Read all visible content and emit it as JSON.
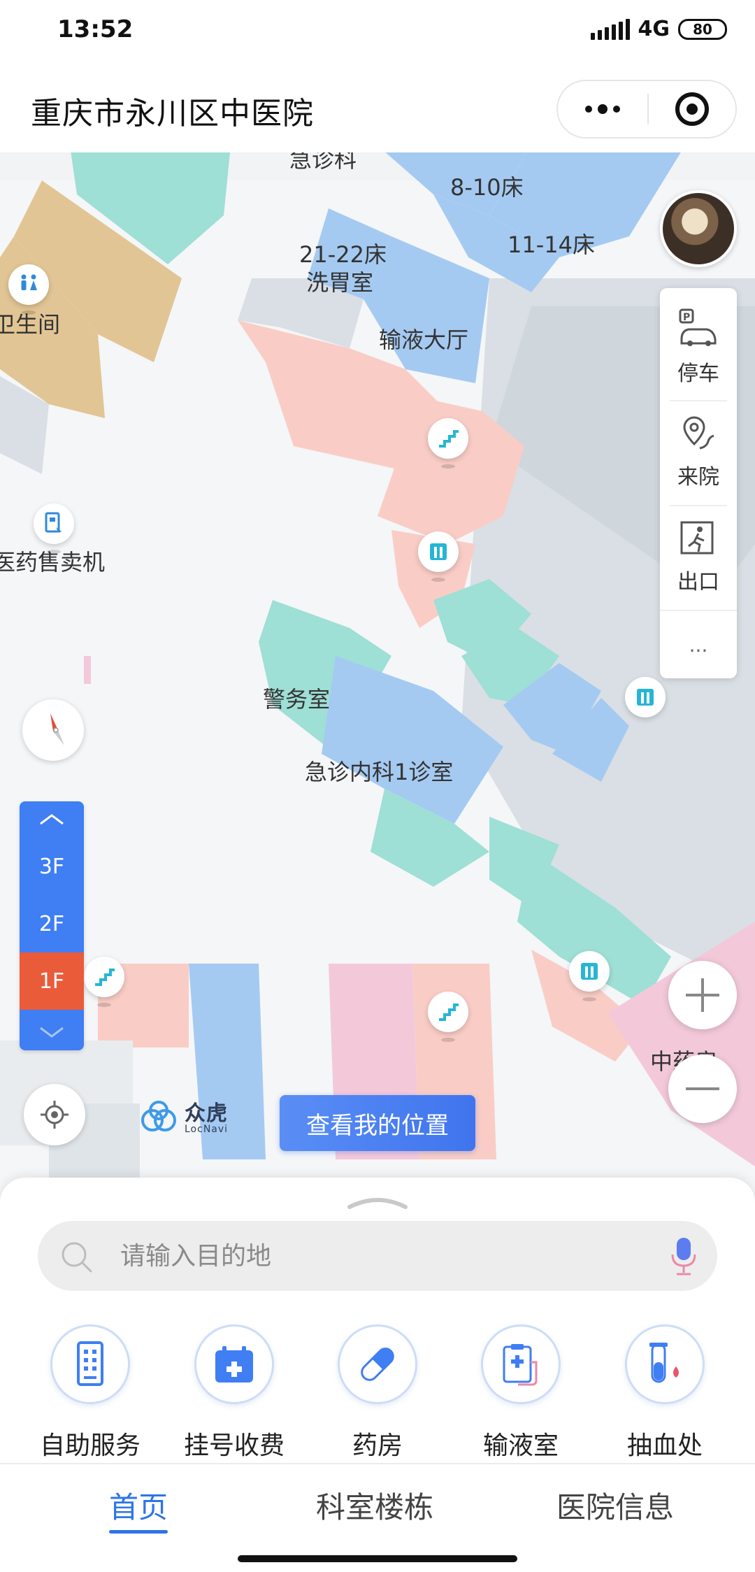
{
  "status_bar": {
    "time": "13:52",
    "network": "4G",
    "battery": "80"
  },
  "header": {
    "title": "重庆市永川区中医院"
  },
  "map": {
    "labels": {
      "emergency": "急诊科",
      "beds_8_10": "8-10床",
      "beds_11_14": "11-14床",
      "beds_21_22": "21-22床",
      "gastric_lavage": "洗胃室",
      "infusion_hall": "输液大厅",
      "restroom": "卫生间",
      "vending": "医药售卖机",
      "police": "警务室",
      "internal_med_1": "急诊内科1诊室",
      "pharmacy_right": "中药房"
    },
    "quick_panel": {
      "parking": "停车",
      "visit": "来院",
      "exit": "出口",
      "more": "..."
    },
    "floors": [
      {
        "label": "3F",
        "active": false
      },
      {
        "label": "2F",
        "active": false
      },
      {
        "label": "1F",
        "active": true
      }
    ],
    "logo": {
      "cn": "众虎",
      "en": "LocNavi"
    },
    "my_location_button": "查看我的位置"
  },
  "search": {
    "placeholder": "请输入目的地"
  },
  "services": [
    {
      "label": "自助服务",
      "icon": "kiosk-icon"
    },
    {
      "label": "挂号收费",
      "icon": "calendar-plus-icon"
    },
    {
      "label": "药房",
      "icon": "pill-icon"
    },
    {
      "label": "输液室",
      "icon": "clipboard-iv-icon"
    },
    {
      "label": "抽血处",
      "icon": "test-tube-icon"
    }
  ],
  "tabs": [
    {
      "label": "首页",
      "active": true
    },
    {
      "label": "科室楼栋",
      "active": false
    },
    {
      "label": "医院信息",
      "active": false
    }
  ],
  "colors": {
    "accent": "#2e75e6",
    "floor_switch": "#3f7ef3",
    "floor_active": "#ea5b3a",
    "room_blue": "#a5caf1",
    "room_teal": "#9edfd6",
    "room_salmon": "#f9cdc6",
    "room_tan": "#e2c594",
    "room_pink": "#f3c9da"
  }
}
